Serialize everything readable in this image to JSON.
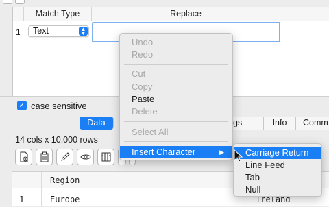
{
  "rules_table": {
    "headers": {
      "match_type": "Match Type",
      "replace": "Replace"
    },
    "row": {
      "number": "1",
      "match_type_value": "Text",
      "replace_value": ""
    }
  },
  "options": {
    "case_sensitive_label": "case sensitive",
    "case_sensitive_checked": true
  },
  "tabs": {
    "data": "Data",
    "settings_partial": "gs",
    "info": "Info",
    "comm_partial": "Comm"
  },
  "summary": "14 cols x 10,000 rows",
  "toolbar_icons": [
    "new-file-icon",
    "paste-file-icon",
    "pencil-icon",
    "eye-icon",
    "columns-icon",
    "table-icon",
    "play-icon"
  ],
  "grid": {
    "header": {
      "region": "Region"
    },
    "rows": [
      {
        "number": "1",
        "region": "Europe",
        "country_partial": "Ireland"
      }
    ]
  },
  "context_menu": {
    "items": [
      {
        "label": "Undo",
        "enabled": false
      },
      {
        "label": "Redo",
        "enabled": false
      },
      {
        "label": "Cut",
        "enabled": false
      },
      {
        "label": "Copy",
        "enabled": false
      },
      {
        "label": "Paste",
        "enabled": true
      },
      {
        "label": "Delete",
        "enabled": false
      },
      {
        "label": "Select All",
        "enabled": false
      },
      {
        "label": "Insert Character",
        "enabled": true,
        "highlighted": true
      }
    ],
    "arrow": "▶"
  },
  "submenu": {
    "items": [
      {
        "label": "Carriage Return",
        "highlighted": true
      },
      {
        "label": "Line Feed"
      },
      {
        "label": "Tab"
      },
      {
        "label": "Null"
      }
    ]
  },
  "colors": {
    "accent": "#1a7ff5",
    "focus_ring": "#7fb0ee",
    "disabled_text": "#a8a8a8"
  }
}
